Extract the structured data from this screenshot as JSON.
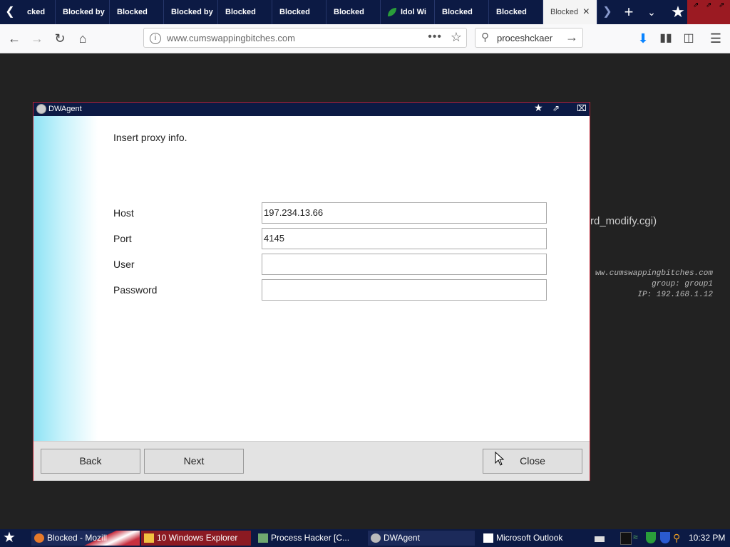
{
  "browser": {
    "tabs": [
      {
        "label": "cked",
        "active": false
      },
      {
        "label": "Blocked by",
        "active": false
      },
      {
        "label": "Blocked",
        "active": false
      },
      {
        "label": "Blocked by",
        "active": false
      },
      {
        "label": "Blocked",
        "active": false
      },
      {
        "label": "Blocked",
        "active": false
      },
      {
        "label": "Blocked",
        "active": false
      },
      {
        "label": "Idol Wi",
        "active": false
      },
      {
        "label": "Blocked",
        "active": false
      },
      {
        "label": "Blocked",
        "active": false
      },
      {
        "label": "Blocked",
        "active": true
      }
    ],
    "url": "www.cumswappingbitches.com",
    "search_value": "proceshckaer"
  },
  "background_page": {
    "line1": "rd_modify.cgi)",
    "line2": "ww.cumswappingbitches.com",
    "line3": "group: group1",
    "line4": "IP: 192.168.1.12"
  },
  "dialog": {
    "title": "DWAgent",
    "prompt": "Insert proxy info.",
    "fields": [
      {
        "label": "Host",
        "value": "197.234.13.66"
      },
      {
        "label": "Port",
        "value": "4145"
      },
      {
        "label": "User",
        "value": ""
      },
      {
        "label": "Password",
        "value": ""
      }
    ],
    "buttons": {
      "back": "Back",
      "next": "Next",
      "close": "Close"
    }
  },
  "taskbar": {
    "items": [
      {
        "label": "Blocked - Mozill"
      },
      {
        "label": "10 Windows Explorer"
      },
      {
        "label": "Process Hacker [C..."
      },
      {
        "label": "DWAgent"
      },
      {
        "label": "Microsoft Outlook"
      }
    ],
    "clock": "10:32 PM"
  },
  "colors": {
    "titlebar": "#0c1a44",
    "accent": "#b22233",
    "dialog_gradient": "#8ee3f5"
  }
}
